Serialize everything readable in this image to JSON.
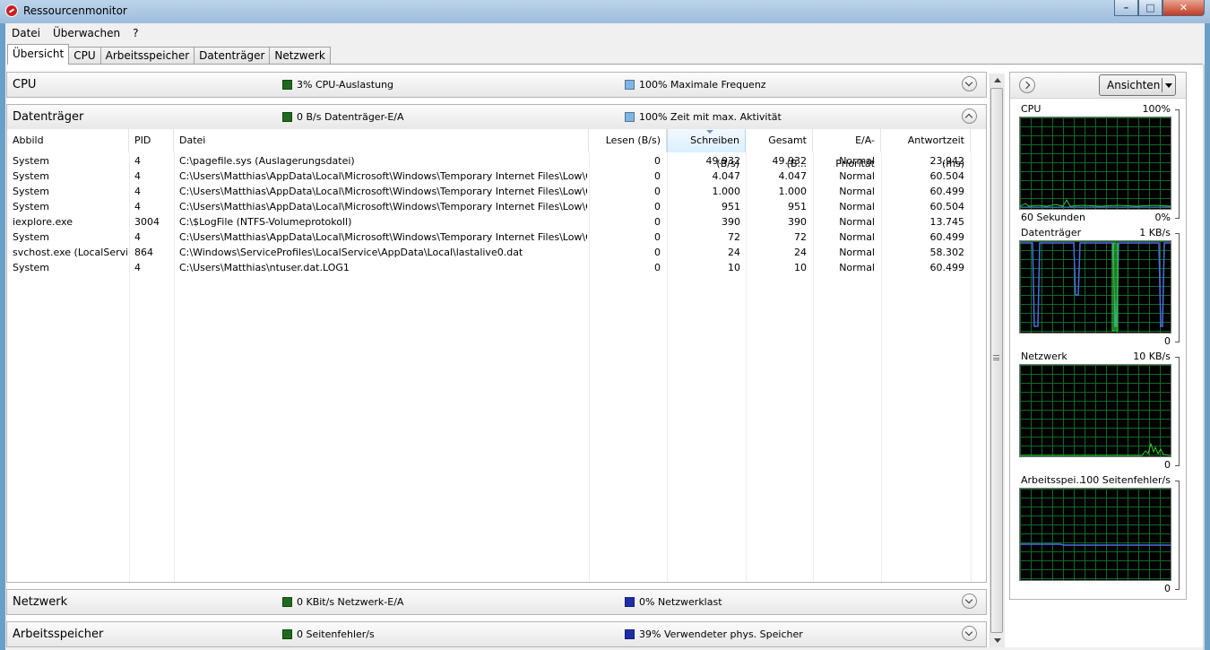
{
  "window": {
    "title": "Ressourcenmonitor"
  },
  "menu": [
    "Datei",
    "Überwachen",
    "?"
  ],
  "tabs": [
    "Übersicht",
    "CPU",
    "Arbeitsspeicher",
    "Datenträger",
    "Netzwerk"
  ],
  "active_tab": "Übersicht",
  "sections": {
    "cpu": {
      "title": "CPU",
      "metric1": "3% CPU-Auslastung",
      "metric1_color": "#1e6b1e",
      "metric2": "100% Maximale Frequenz",
      "metric2_color": "#7fb5e6"
    },
    "disk": {
      "title": "Datenträger",
      "metric1": "0 B/s Datenträger-E/A",
      "metric1_color": "#1e6b1e",
      "metric2": "100% Zeit mit max. Aktivität",
      "metric2_color": "#7fb5e6"
    },
    "network": {
      "title": "Netzwerk",
      "metric1": "0 KBit/s Netzwerk-E/A",
      "metric1_color": "#1e6b1e",
      "metric2": "0% Netzwerklast",
      "metric2_color": "#1c2fa8"
    },
    "memory": {
      "title": "Arbeitsspeicher",
      "metric1": "0 Seitenfehler/s",
      "metric1_color": "#1e6b1e",
      "metric2": "39% Verwendeter phys. Speicher",
      "metric2_color": "#1c2fa8"
    }
  },
  "disk_table": {
    "headers": [
      "Abbild",
      "PID",
      "Datei",
      "Lesen (B/s)",
      "Schreiben (B/s)",
      "Gesamt (B...",
      "E/A-Priorität",
      "Antwortzeit (ms)"
    ],
    "sorted_column": "Schreiben (B/s)",
    "rows": [
      [
        "System",
        "4",
        "C:\\pagefile.sys (Auslagerungsdatei)",
        "0",
        "49.932",
        "49.932",
        "Normal",
        "23.942"
      ],
      [
        "System",
        "4",
        "C:\\Users\\Matthias\\AppData\\Local\\Microsoft\\Windows\\Temporary Internet Files\\Low\\C...",
        "0",
        "4.047",
        "4.047",
        "Normal",
        "60.504"
      ],
      [
        "System",
        "4",
        "C:\\Users\\Matthias\\AppData\\Local\\Microsoft\\Windows\\Temporary Internet Files\\Low\\C...",
        "0",
        "1.000",
        "1.000",
        "Normal",
        "60.499"
      ],
      [
        "System",
        "4",
        "C:\\Users\\Matthias\\AppData\\Local\\Microsoft\\Windows\\Temporary Internet Files\\Low\\C...",
        "0",
        "951",
        "951",
        "Normal",
        "60.504"
      ],
      [
        "iexplore.exe",
        "3004",
        "C:\\$LogFile (NTFS-Volumeprotokoll)",
        "0",
        "390",
        "390",
        "Normal",
        "13.745"
      ],
      [
        "System",
        "4",
        "C:\\Users\\Matthias\\AppData\\Local\\Microsoft\\Windows\\Temporary Internet Files\\Low\\C...",
        "0",
        "72",
        "72",
        "Normal",
        "60.499"
      ],
      [
        "svchost.exe (LocalServi...",
        "864",
        "C:\\Windows\\ServiceProfiles\\LocalService\\AppData\\Local\\lastalive0.dat",
        "0",
        "24",
        "24",
        "Normal",
        "58.302"
      ],
      [
        "System",
        "4",
        "C:\\Users\\Matthias\\ntuser.dat.LOG1",
        "0",
        "10",
        "10",
        "Normal",
        "60.499"
      ]
    ]
  },
  "right_panel": {
    "views_button": "Ansichten",
    "graphs": {
      "cpu": {
        "label": "CPU",
        "max": "100%",
        "footer_left": "60 Sekunden",
        "footer_right": "0%"
      },
      "disk": {
        "label": "Datenträger",
        "max": "1 KB/s",
        "footer_right": "0"
      },
      "network": {
        "label": "Netzwerk",
        "max": "10 KB/s",
        "footer_right": "0"
      },
      "memory": {
        "label": "Arbeitsspei...",
        "max": "100 Seitenfehler/s",
        "footer_right": "0"
      }
    }
  },
  "colors": {
    "graph_grid": "#0f6b2a",
    "graph_green": "#2fd02f",
    "graph_blue": "#4a6fe0"
  }
}
